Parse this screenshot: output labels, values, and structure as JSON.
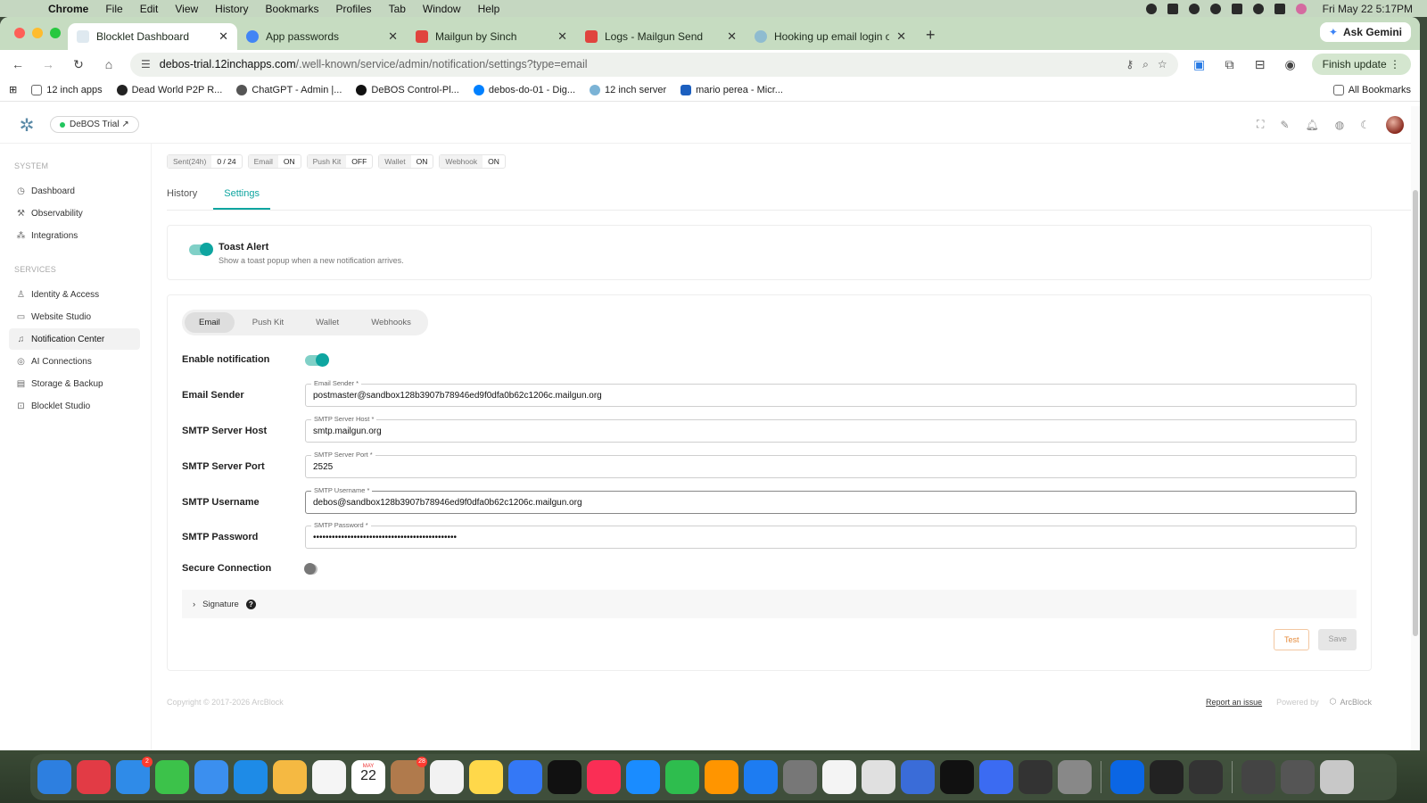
{
  "menubar": {
    "app": "Chrome",
    "items": [
      "File",
      "Edit",
      "View",
      "History",
      "Bookmarks",
      "Profiles",
      "Tab",
      "Window",
      "Help"
    ],
    "clock": "Fri May 22  5:17PM"
  },
  "browser": {
    "tabs": [
      {
        "title": "Blocklet Dashboard",
        "color": "#ffffff"
      },
      {
        "title": "App passwords",
        "color": "#4285f4"
      },
      {
        "title": "Mailgun by Sinch",
        "color": "#e0443e"
      },
      {
        "title": "Logs - Mailgun Send",
        "color": "#e0443e"
      },
      {
        "title": "Hooking up email login on se",
        "color": "#5aa0c8"
      }
    ],
    "new_tab": "+",
    "gemini": "Ask Gemini",
    "url_host": "debos-trial.12inchapps.com",
    "url_path": "/.well-known/service/admin/notification/settings?type=email",
    "finish_update": "Finish update",
    "bookmarks": [
      {
        "label": "12 inch apps",
        "color": "#666"
      },
      {
        "label": "Dead World P2P R...",
        "color": "#222"
      },
      {
        "label": "ChatGPT - Admin |...",
        "color": "#555"
      },
      {
        "label": "DeBOS Control-Pl...",
        "color": "#111"
      },
      {
        "label": "debos-do-01 - Dig...",
        "color": "#0080ff"
      },
      {
        "label": "12 inch server",
        "color": "#7bb3d6"
      },
      {
        "label": "mario perea - Micr...",
        "color": "#1c5fbf"
      }
    ],
    "all_bookmarks": "All Bookmarks"
  },
  "app": {
    "trial_label": "DeBOS Trial ↗",
    "sidebar": {
      "system_label": "SYSTEM",
      "system_items": [
        "Dashboard",
        "Observability",
        "Integrations"
      ],
      "services_label": "SERVICES",
      "services_items": [
        "Identity & Access",
        "Website Studio",
        "Notification Center",
        "AI Connections",
        "Storage & Backup",
        "Blocklet Studio"
      ]
    },
    "chips": [
      {
        "key": "Sent(24h)",
        "value": "0 / 24"
      },
      {
        "key": "Email",
        "value": "ON"
      },
      {
        "key": "Push Kit",
        "value": "OFF"
      },
      {
        "key": "Wallet",
        "value": "ON"
      },
      {
        "key": "Webhook",
        "value": "ON"
      }
    ],
    "tabs": [
      "History",
      "Settings"
    ],
    "toast": {
      "title": "Toast Alert",
      "description": "Show a toast popup when a new notification arrives."
    },
    "channels": [
      "Email",
      "Push Kit",
      "Wallet",
      "Webhooks"
    ],
    "form": {
      "enable_label": "Enable notification",
      "sender_label": "Email Sender",
      "sender_float": "Email Sender *",
      "sender_value": "postmaster@sandbox128b3907b78946ed9f0dfa0b62c1206c.mailgun.org",
      "host_label": "SMTP Server Host",
      "host_float": "SMTP Server Host *",
      "host_value": "smtp.mailgun.org",
      "port_label": "SMTP Server Port",
      "port_float": "SMTP Server Port *",
      "port_value": "2525",
      "user_label": "SMTP Username",
      "user_float": "SMTP Username *",
      "user_value": "debos@sandbox128b3907b78946ed9f0dfa0b62c1206c.mailgun.org",
      "pass_label": "SMTP Password",
      "pass_float": "SMTP Password *",
      "pass_value": "••••••••••••••••••••••••••••••••••••••••••••••",
      "secure_label": "Secure Connection",
      "signature_label": "Signature",
      "test_button": "Test",
      "save_button": "Save"
    },
    "footer": {
      "copyright": "Copyright © 2017-2026  ArcBlock",
      "report": "Report an issue",
      "powered_by": "Powered by",
      "brand": "ArcBlock"
    }
  },
  "dock": {
    "colors": [
      "#2d7fe0",
      "#e23b45",
      "#2f8be8",
      "#3cc24a",
      "#3b8fef",
      "#1e8be7",
      "#f5b942",
      "#f5f5f5",
      "#34c759",
      "#b07a4c",
      "#f2f2f2",
      "#ffd84a",
      "#3478f6",
      "#111111",
      "#fa2e55",
      "#1a8cff",
      "#2ebd4e",
      "#ff9500",
      "#1d7cf2",
      "#777777",
      "#f4f4f4",
      "#e0e0e0",
      "#3a6cd8",
      "#111111",
      "#3b6bf2",
      "#333333",
      "#888888",
      "#0b66e4",
      "#222222",
      "#333333",
      "#444444",
      "#555555",
      "#c8c8c8"
    ],
    "badges": {
      "2": "2",
      "9": "28"
    },
    "date_label": "MAY",
    "date_day": "22"
  }
}
